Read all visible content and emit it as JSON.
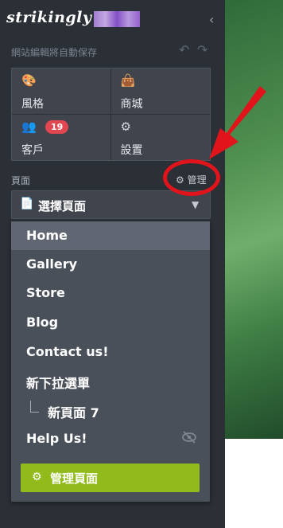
{
  "brand": {
    "logo": "strikingly"
  },
  "toolbar": {
    "autosave_text": "網站編輯將自動保存"
  },
  "tiles": [
    {
      "label": "風格"
    },
    {
      "label": "商城"
    },
    {
      "label": "客戶",
      "badge": "19"
    },
    {
      "label": "設置"
    }
  ],
  "pages": {
    "section_label": "頁面",
    "manage_label": "管理",
    "select_label": "選擇頁面",
    "items": [
      {
        "label": "Home"
      },
      {
        "label": "Gallery"
      },
      {
        "label": "Store"
      },
      {
        "label": "Blog"
      },
      {
        "label": "Contact us!"
      },
      {
        "label": "新下拉選單"
      },
      {
        "label": "新頁面 7"
      },
      {
        "label": "Help Us!"
      }
    ],
    "manage_button": "管理頁面"
  },
  "colors": {
    "accent_green": "#91bb1b",
    "callout_red": "#e0141a",
    "badge_red": "#e24650"
  }
}
